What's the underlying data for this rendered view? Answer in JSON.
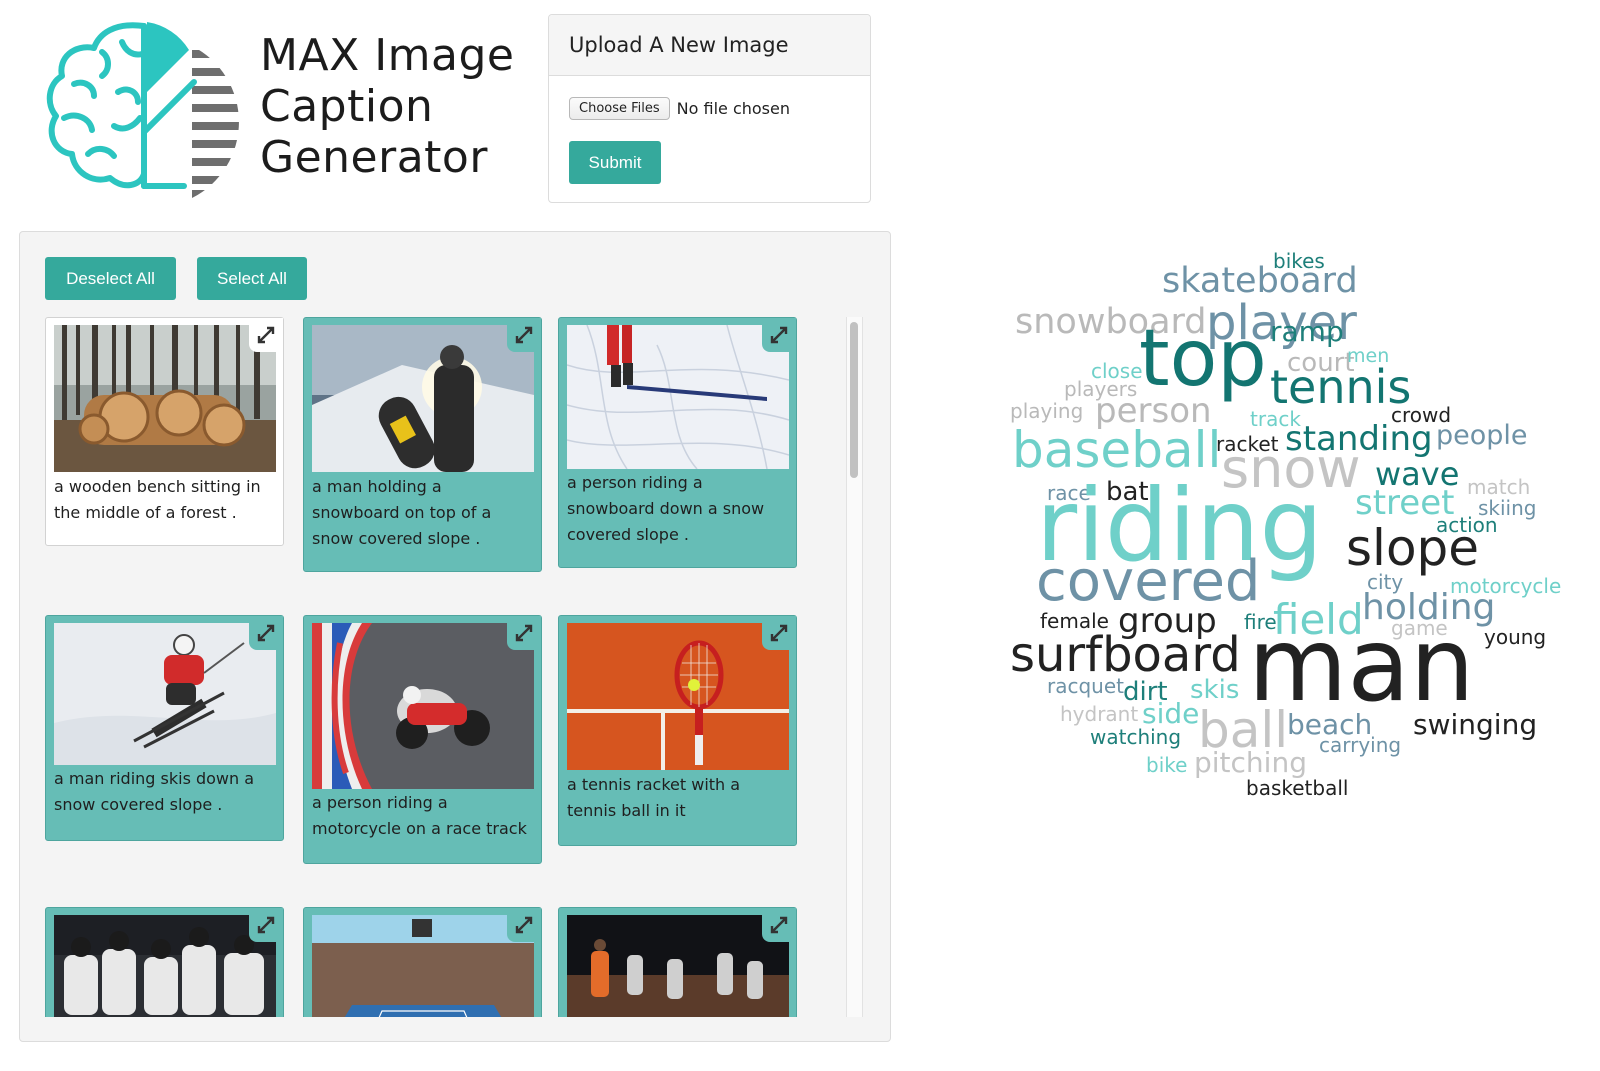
{
  "app": {
    "title_lines": [
      "MAX Image",
      "Caption",
      "Generator"
    ],
    "logo_icon": "brain-logo-icon",
    "colors": {
      "teal": "#35a99c",
      "logo_teal": "#2cc5c0",
      "logo_gray": "#6e6e6e"
    }
  },
  "upload": {
    "header": "Upload A New Image",
    "choose_label": "Choose Files",
    "file_status": "No file chosen",
    "submit_label": "Submit"
  },
  "gallery": {
    "deselect_label": "Deselect All",
    "select_label": "Select All",
    "expand_icon": "expand-icon",
    "cards": [
      {
        "caption": "a wooden bench sitting in the middle of a forest .",
        "selected": false,
        "image": "forest logs"
      },
      {
        "caption": "a man holding a snowboard on top of a snow covered slope .",
        "selected": true,
        "image": "snowboarder"
      },
      {
        "caption": "a person riding a snowboard down a snow covered slope .",
        "selected": true,
        "image": "snow slope"
      },
      {
        "caption": "a man riding skis down a snow covered slope .",
        "selected": true,
        "image": "skier"
      },
      {
        "caption": "a person riding a motorcycle on a race track",
        "selected": true,
        "image": "motorcycle"
      },
      {
        "caption": "a tennis racket with a tennis ball in it",
        "selected": true,
        "image": "tennis racket"
      },
      {
        "caption": "",
        "selected": true,
        "image": "baseball team"
      },
      {
        "caption": "",
        "selected": true,
        "image": "tennis stadium"
      },
      {
        "caption": "",
        "selected": true,
        "image": "basketball"
      }
    ]
  },
  "word_cloud": {
    "words": [
      {
        "text": "bikes",
        "color": "#1e7f7a"
      },
      {
        "text": "skateboard",
        "color": "#6e92a6"
      },
      {
        "text": "snowboard",
        "color": "#b9b9b9"
      },
      {
        "text": "player",
        "color": "#6e92a6"
      },
      {
        "text": "ramp",
        "color": "#1e7f7a"
      },
      {
        "text": "top",
        "color": "#137571"
      },
      {
        "text": "court",
        "color": "#b9b9b9"
      },
      {
        "text": "men",
        "color": "#6fd0c9"
      },
      {
        "text": "close",
        "color": "#6fd0c9"
      },
      {
        "text": "tennis",
        "color": "#137571"
      },
      {
        "text": "players",
        "color": "#b9b9b9"
      },
      {
        "text": "playing",
        "color": "#b9b9b9"
      },
      {
        "text": "person",
        "color": "#b9b9b9"
      },
      {
        "text": "track",
        "color": "#6fd0c9"
      },
      {
        "text": "crowd",
        "color": "#222222"
      },
      {
        "text": "baseball",
        "color": "#6fd0c9"
      },
      {
        "text": "racket",
        "color": "#222222"
      },
      {
        "text": "standing",
        "color": "#137571"
      },
      {
        "text": "people",
        "color": "#6e92a6"
      },
      {
        "text": "snow",
        "color": "#c4c4c4"
      },
      {
        "text": "wave",
        "color": "#137571"
      },
      {
        "text": "race",
        "color": "#6e92a6"
      },
      {
        "text": "bat",
        "color": "#222222"
      },
      {
        "text": "match",
        "color": "#c4c4c4"
      },
      {
        "text": "riding",
        "color": "#6fd0c9"
      },
      {
        "text": "street",
        "color": "#6fd0c9"
      },
      {
        "text": "skiing",
        "color": "#6e92a6"
      },
      {
        "text": "action",
        "color": "#1e7f7a"
      },
      {
        "text": "slope",
        "color": "#222222"
      },
      {
        "text": "covered",
        "color": "#6e92a6"
      },
      {
        "text": "city",
        "color": "#6e92a6"
      },
      {
        "text": "motorcycle",
        "color": "#6fd0c9"
      },
      {
        "text": "holding",
        "color": "#6e92a6"
      },
      {
        "text": "female",
        "color": "#222222"
      },
      {
        "text": "group",
        "color": "#222222"
      },
      {
        "text": "fire",
        "color": "#1e7f7a"
      },
      {
        "text": "field",
        "color": "#6fd0c9"
      },
      {
        "text": "game",
        "color": "#c4c4c4"
      },
      {
        "text": "young",
        "color": "#222222"
      },
      {
        "text": "surfboard",
        "color": "#222222"
      },
      {
        "text": "man",
        "color": "#222222"
      },
      {
        "text": "racquet",
        "color": "#6e92a6"
      },
      {
        "text": "dirt",
        "color": "#1e7f7a"
      },
      {
        "text": "skis",
        "color": "#6fd0c9"
      },
      {
        "text": "hydrant",
        "color": "#c4c4c4"
      },
      {
        "text": "side",
        "color": "#6fd0c9"
      },
      {
        "text": "ball",
        "color": "#c4c4c4"
      },
      {
        "text": "beach",
        "color": "#6e92a6"
      },
      {
        "text": "swinging",
        "color": "#222222"
      },
      {
        "text": "watching",
        "color": "#1e7f7a"
      },
      {
        "text": "carrying",
        "color": "#6e92a6"
      },
      {
        "text": "bike",
        "color": "#6fd0c9"
      },
      {
        "text": "pitching",
        "color": "#c4c4c4"
      },
      {
        "text": "basketball",
        "color": "#222222"
      }
    ]
  }
}
